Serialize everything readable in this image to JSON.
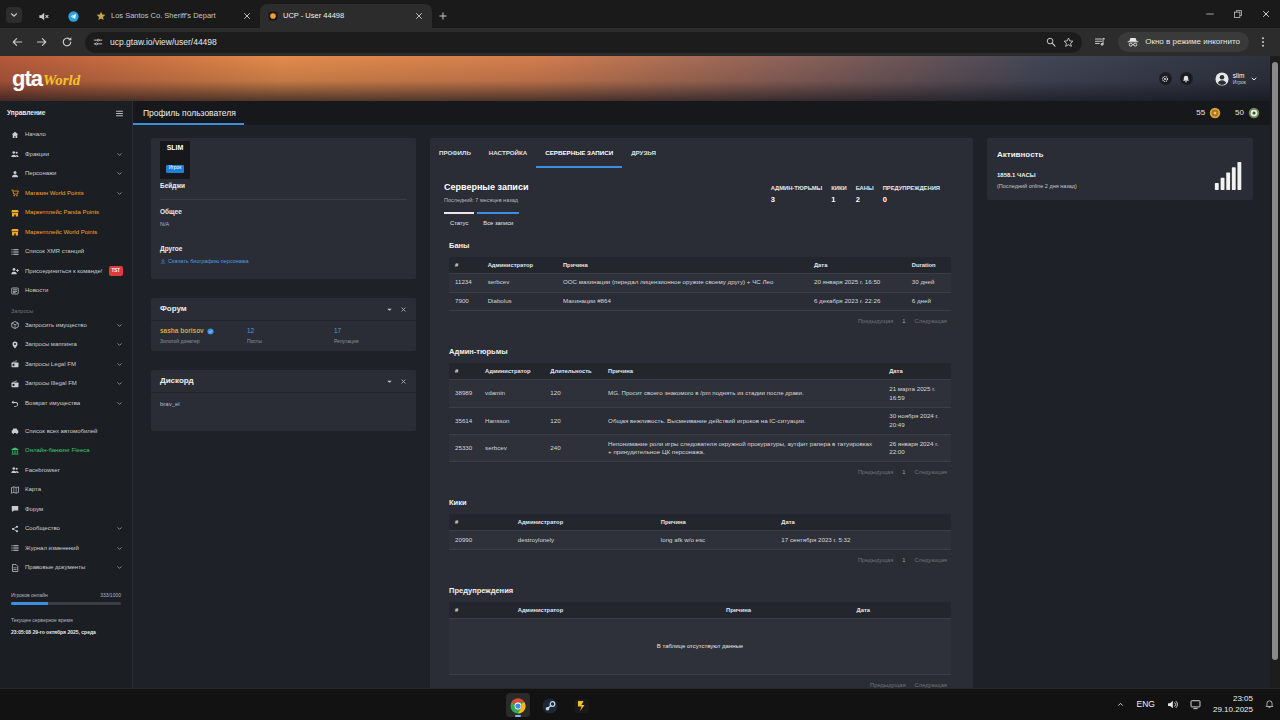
{
  "browser": {
    "pinned_tabs": [
      {
        "selected": false
      },
      {
        "selected": false
      }
    ],
    "tabs": [
      {
        "label": "Los Santos Co. Sheriff's Depart",
        "selected": false
      },
      {
        "label": "UCP - User 44498",
        "selected": true
      }
    ],
    "address": "ucp.gtaw.io/view/user/44498",
    "incognito": "Окно в режиме инкогнито"
  },
  "site": {
    "logo": {
      "main": "gta",
      "script": "World"
    },
    "user": {
      "name": "slim",
      "role": "Игрок"
    },
    "page_title": "Профиль пользователя",
    "currencies": [
      "55",
      "50"
    ]
  },
  "sidebar": {
    "title": "Управление",
    "groups": [
      {
        "items": [
          {
            "label": "Начало",
            "expandable": false,
            "color": "#c9cdd3"
          },
          {
            "label": "Фракции",
            "expandable": true,
            "color": "#c9cdd3"
          },
          {
            "label": "Персонажи",
            "expandable": true,
            "color": "#c9cdd3"
          },
          {
            "label": "Магазин World Points",
            "expandable": true,
            "color": "#f5a623"
          },
          {
            "label": "Маркетплейс Panda Points",
            "expandable": false,
            "color": "#f5a623"
          },
          {
            "label": "Маркетплейс World Points",
            "expandable": false,
            "color": "#f5a623"
          },
          {
            "label": "Список XMR станций",
            "expandable": false,
            "color": "#c9cdd3"
          },
          {
            "label": "Присоединиться к команде!",
            "expandable": false,
            "color": "#c9cdd3",
            "badge": "TST"
          },
          {
            "label": "Новости",
            "expandable": false,
            "color": "#c9cdd3"
          }
        ]
      },
      {
        "heading": "Запросы",
        "items": [
          {
            "label": "Запросить имущество",
            "expandable": true,
            "color": "#c9cdd3"
          },
          {
            "label": "Запросы маппинга",
            "expandable": true,
            "color": "#c9cdd3"
          },
          {
            "label": "Запросы Legal FM",
            "expandable": true,
            "color": "#c9cdd3"
          },
          {
            "label": "Запросы Illegal FM",
            "expandable": true,
            "color": "#c9cdd3"
          },
          {
            "label": "Возврат имущества",
            "expandable": true,
            "color": "#c9cdd3"
          }
        ]
      },
      {
        "items": [
          {
            "label": "Список всех автомобилей",
            "expandable": false,
            "color": "#c9cdd3"
          },
          {
            "label": "Онлайн-банкинг Fleeca",
            "expandable": false,
            "color": "#3ec46d"
          },
          {
            "label": "Facebrowser",
            "expandable": false,
            "color": "#c9cdd3"
          },
          {
            "label": "Карта",
            "expandable": false,
            "color": "#c9cdd3"
          },
          {
            "label": "Форум",
            "expandable": false,
            "color": "#c9cdd3"
          },
          {
            "label": "Сообщество",
            "expandable": true,
            "color": "#c9cdd3"
          },
          {
            "label": "Журнал изменений",
            "expandable": true,
            "color": "#c9cdd3"
          },
          {
            "label": "Правовые документы",
            "expandable": true,
            "color": "#c9cdd3"
          }
        ]
      }
    ],
    "online": {
      "label": "Игроков онлайн",
      "value": "333/1000",
      "level": 0.333
    },
    "server_time": {
      "label": "Текущее серверное время",
      "value": "23:05:08 29-го октября 2025, среда"
    }
  },
  "profile": {
    "name": "SLIM",
    "role": "Игрок",
    "sections": [
      {
        "title": "Бейджи"
      },
      {
        "title": "Общее",
        "value": "N/A"
      },
      {
        "title": "Другое",
        "link": "Скачать биографию персонажа"
      }
    ]
  },
  "forum": {
    "title": "Форум",
    "user": "sasha borisov",
    "rank": "Золотой донатер",
    "stats": [
      {
        "value": "12",
        "label": "Посты"
      },
      {
        "value": "17",
        "label": "Репутация"
      }
    ]
  },
  "discord": {
    "title": "Дискорд",
    "user": "brav_el"
  },
  "records": {
    "tabs": [
      {
        "label": "ПРОФИЛЬ",
        "selected": false
      },
      {
        "label": "НАСТРОЙКА",
        "selected": false
      },
      {
        "label": "СЕРВЕРНЫЕ ЗАПИСИ",
        "selected": true
      },
      {
        "label": "ДРУЗЬЯ",
        "selected": false
      }
    ],
    "title": "Серверные записи",
    "last": "Последний: 7 месяцев назад",
    "stats": [
      {
        "label": "АДМИН-ТЮРЬМЫ",
        "value": "3"
      },
      {
        "label": "КИКИ",
        "value": "1"
      },
      {
        "label": "БАНЫ",
        "value": "2"
      },
      {
        "label": "ПРЕДУПРЕЖДЕНИЯ",
        "value": "0"
      }
    ],
    "subtabs": [
      {
        "label": "Статус",
        "selected": false
      },
      {
        "label": "Все записи",
        "selected": true
      }
    ],
    "tables": [
      {
        "title": "Баны",
        "columns": [
          "#",
          "Администратор",
          "Причина",
          "Дата",
          "Duration"
        ],
        "rows": [
          [
            "11234",
            "serbcev",
            "OOC махинации (передал лицензионное оружие своему другу) + ЧС Лео",
            "20 января 2025 г. 16:50",
            "30 дней"
          ],
          [
            "7900",
            "Diabolus",
            "Махинации #864",
            "6 декабря 2023 г. 22:26",
            "6 дней"
          ]
        ],
        "pager": {
          "prev": {
            "label": "Предыдущая",
            "disabled": true
          },
          "page": "1",
          "next": {
            "label": "Следующая",
            "disabled": true
          }
        }
      },
      {
        "title": "Админ-тюрьмы",
        "columns": [
          "#",
          "Администратор",
          "Длительность",
          "Причина",
          "Дата"
        ],
        "rows": [
          [
            "38989",
            "vdamin",
            "120",
            "MG. Просит своего знакомого в /pm поднять из стадии после драки.",
            "21 марта 2025 г. 16:59"
          ],
          [
            "35614",
            "Hansson",
            "120",
            "Общая вежливость. Высмеивание действий игроков на IC-ситуации.",
            "30 ноября 2024 г. 20:49"
          ],
          [
            "25330",
            "serbcev",
            "240",
            "Непонимание роли игры следователя окружной прокуратуры, аутфит рапера в татуировках + принудительное ЦК персонажа.",
            "26 января 2024 г. 22:00"
          ]
        ],
        "pager": {
          "prev": {
            "label": "Предыдущая",
            "disabled": true
          },
          "page": "1",
          "next": {
            "label": "Следующая",
            "disabled": true
          }
        }
      },
      {
        "title": "Кики",
        "columns": [
          "#",
          "Администратор",
          "Причина",
          "Дата"
        ],
        "rows": [
          [
            "20990",
            "destroylonely",
            "long afk w/o esc",
            "17 сентября 2023 г. 5:32"
          ]
        ],
        "pager": {
          "prev": {
            "label": "Предыдущая",
            "disabled": true
          },
          "page": "1",
          "next": {
            "label": "Следующая",
            "disabled": true
          }
        }
      },
      {
        "title": "Предупреждения",
        "columns": [
          "#",
          "Администратор",
          "Причина",
          "Дата"
        ],
        "rows": [],
        "empty": "В таблице отсутствуют данные",
        "pager": {
          "prev": {
            "label": "Предыдущая",
            "disabled": true
          },
          "next": {
            "label": "Следующая",
            "disabled": true
          }
        }
      }
    ]
  },
  "activity": {
    "title": "Активность",
    "hours": "1858.1 ЧАСЫ",
    "last": "(Последний online 2 дня назад)"
  },
  "taskbar": {
    "apps": [
      {
        "selected": true
      },
      {
        "selected": false
      },
      {
        "selected": false
      }
    ],
    "lang": "ENG",
    "time": "23:05",
    "date": "29.10.2025"
  }
}
